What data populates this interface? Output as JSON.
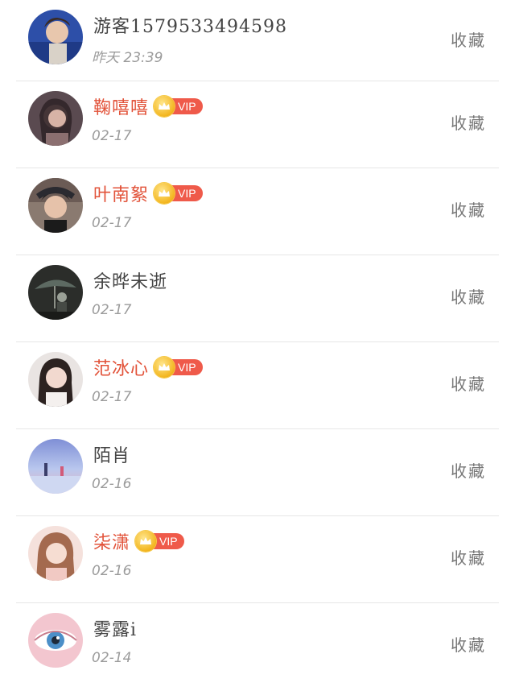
{
  "users": [
    {
      "name": "游客15795334945​98",
      "time": "昨天 23:39",
      "vip": false,
      "vip_label": "",
      "fav_label": "收藏",
      "avatar": "avatar-portrait-blue"
    },
    {
      "name": "鞠嘻嘻",
      "time": "02-17",
      "vip": true,
      "vip_label": "VIP",
      "fav_label": "收藏",
      "avatar": "avatar-portrait-girl-dark"
    },
    {
      "name": "叶南絮",
      "time": "02-17",
      "vip": true,
      "vip_label": "VIP",
      "fav_label": "收藏",
      "avatar": "avatar-portrait-boy-hat"
    },
    {
      "name": "余晔未逝",
      "time": "02-17",
      "vip": false,
      "vip_label": "",
      "fav_label": "收藏",
      "avatar": "avatar-umbrella-scene"
    },
    {
      "name": "范冰心",
      "time": "02-17",
      "vip": true,
      "vip_label": "VIP",
      "fav_label": "收藏",
      "avatar": "avatar-portrait-girl-light"
    },
    {
      "name": "陌肖",
      "time": "02-16",
      "vip": false,
      "vip_label": "",
      "fav_label": "收藏",
      "avatar": "avatar-beach-sky"
    },
    {
      "name": "柒潇",
      "time": "02-16",
      "vip": true,
      "vip_label": "VIP",
      "fav_label": "收藏",
      "avatar": "avatar-portrait-girl-pink"
    },
    {
      "name": "雾露i",
      "time": "02-14",
      "vip": false,
      "vip_label": "",
      "fav_label": "收藏",
      "avatar": "avatar-eye-closeup"
    }
  ],
  "colors": {
    "vip_name": "#e2533a",
    "vip_tag": "#ef5a4a",
    "crown": "#f3b61f",
    "name": "#444444",
    "time": "#9b9b9b",
    "fav": "#777777",
    "divider": "#e6e6e6"
  }
}
